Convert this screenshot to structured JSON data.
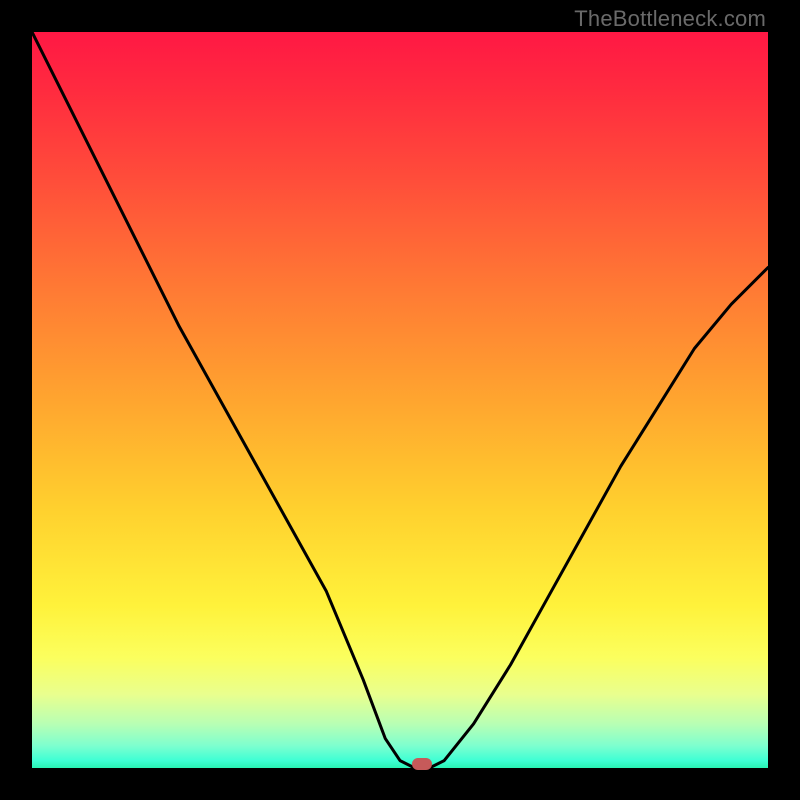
{
  "watermark": "TheBottleneck.com",
  "marker_color": "#c65a5a",
  "curve_color": "#000000",
  "gradient": {
    "top": "#ff1844",
    "bottom": "#29f3b4"
  },
  "chart_data": {
    "type": "line",
    "title": "",
    "xlabel": "",
    "ylabel": "",
    "xlim": [
      0,
      100
    ],
    "ylim": [
      0,
      100
    ],
    "grid": false,
    "legend": false,
    "annotations": [],
    "note": "Axes are unlabeled; values estimated from plotted curve position relative to gradient area (0 = bottom/left, 100 = top/right).",
    "series": [
      {
        "name": "curve",
        "x": [
          0,
          5,
          10,
          15,
          20,
          25,
          30,
          35,
          40,
          45,
          48,
          50,
          52,
          54,
          56,
          60,
          65,
          70,
          75,
          80,
          85,
          90,
          95,
          100
        ],
        "y": [
          100,
          90,
          80,
          70,
          60,
          51,
          42,
          33,
          24,
          12,
          4,
          1,
          0,
          0,
          1,
          6,
          14,
          23,
          32,
          41,
          49,
          57,
          63,
          68
        ]
      }
    ],
    "marker": {
      "x": 53,
      "y": 0.5,
      "shape": "rounded-rect",
      "color": "#c65a5a"
    }
  }
}
